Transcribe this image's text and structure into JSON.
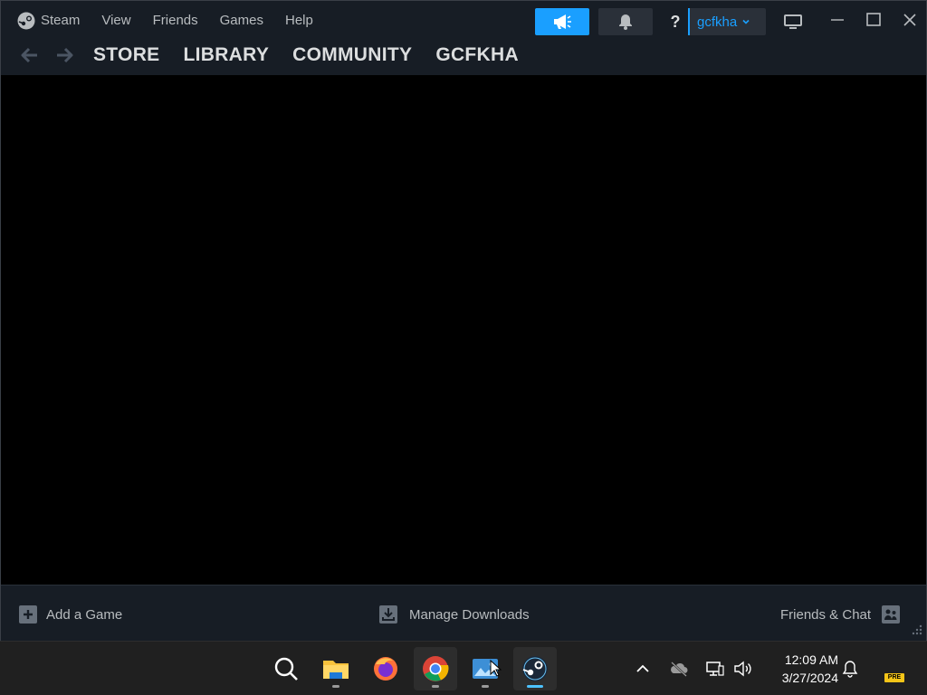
{
  "menu": {
    "items": [
      "Steam",
      "View",
      "Friends",
      "Games",
      "Help"
    ]
  },
  "nav": {
    "tabs": [
      "STORE",
      "LIBRARY",
      "COMMUNITY",
      "GCFKHA"
    ]
  },
  "account": {
    "help_label": "?",
    "username": "gcfkha"
  },
  "footer": {
    "add_game": "Add a Game",
    "manage_downloads": "Manage Downloads",
    "friends_chat": "Friends & Chat"
  },
  "taskbar": {
    "apps": [
      "search-icon",
      "file-explorer-icon",
      "firefox-icon",
      "chrome-icon",
      "photos-icon",
      "steam-icon"
    ],
    "time": "12:09 AM",
    "date": "3/27/2024",
    "badge": "PRE"
  },
  "colors": {
    "accent": "#1a9fff",
    "titlebar": "#171d25",
    "taskbar": "#202020"
  }
}
